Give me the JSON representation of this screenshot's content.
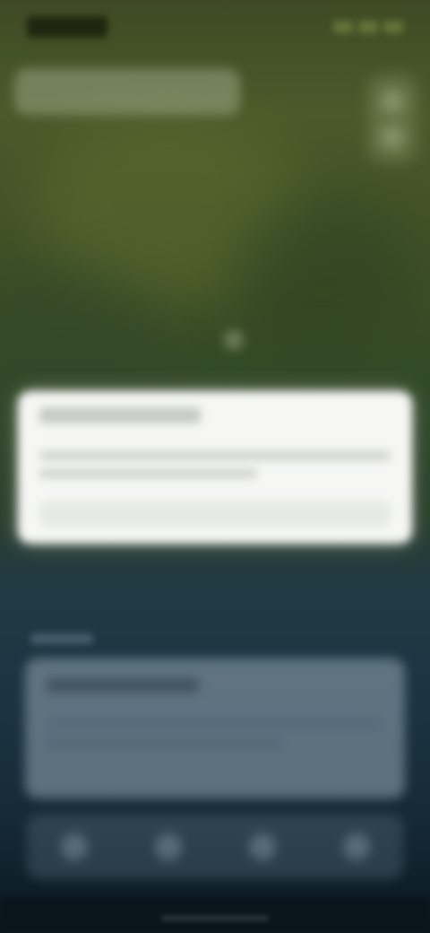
{
  "status_bar": {
    "time": "",
    "icons": [
      "signal-icon",
      "wifi-icon",
      "battery-icon"
    ]
  },
  "top_bar": {
    "search_text": ""
  },
  "map_controls": {
    "icons": [
      "layers-icon",
      "compass-icon"
    ]
  },
  "info_card": {
    "title": "",
    "body": "",
    "button_label": ""
  },
  "bottom_panel": {
    "section_label": "",
    "card_title": "",
    "card_body": ""
  },
  "actions_bar": {
    "icons": [
      "action-icon-1",
      "action-icon-2",
      "action-icon-3",
      "action-icon-4"
    ]
  },
  "colors": {
    "map_green": "#3d4e25",
    "panel_blue": "#1c3442",
    "card_white": "#f6f7f4"
  }
}
